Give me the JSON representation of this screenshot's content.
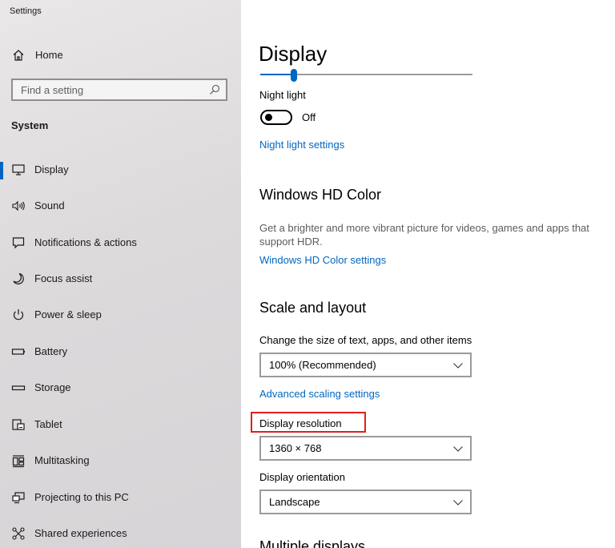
{
  "app": {
    "title": "Settings"
  },
  "sidebar": {
    "home_label": "Home",
    "search_placeholder": "Find a setting",
    "section": "System",
    "items": [
      {
        "label": "Display",
        "icon": "monitor-icon",
        "active": true
      },
      {
        "label": "Sound",
        "icon": "speaker-icon"
      },
      {
        "label": "Notifications & actions",
        "icon": "notification-icon"
      },
      {
        "label": "Focus assist",
        "icon": "moon-icon"
      },
      {
        "label": "Power & sleep",
        "icon": "power-icon"
      },
      {
        "label": "Battery",
        "icon": "battery-icon"
      },
      {
        "label": "Storage",
        "icon": "storage-icon"
      },
      {
        "label": "Tablet",
        "icon": "tablet-icon"
      },
      {
        "label": "Multitasking",
        "icon": "multitasking-icon"
      },
      {
        "label": "Projecting to this PC",
        "icon": "projecting-icon"
      },
      {
        "label": "Shared experiences",
        "icon": "shared-experiences-icon"
      }
    ]
  },
  "main": {
    "title": "Display",
    "brightness_level": 0.16,
    "night_light": {
      "label": "Night light",
      "state": "Off",
      "link": "Night light settings"
    },
    "hd_color": {
      "heading": "Windows HD Color",
      "description": "Get a brighter and more vibrant picture for videos, games and apps that support HDR.",
      "link": "Windows HD Color settings"
    },
    "scale_layout": {
      "heading": "Scale and layout",
      "scale_label": "Change the size of text, apps, and other items",
      "scale_value": "100% (Recommended)",
      "advanced_link": "Advanced scaling settings",
      "resolution_label": "Display resolution",
      "resolution_value": "1360 × 768",
      "orientation_label": "Display orientation",
      "orientation_value": "Landscape"
    },
    "multiple_displays_heading": "Multiple displays"
  },
  "colors": {
    "accent": "#0067c0",
    "highlight": "#e02020"
  }
}
